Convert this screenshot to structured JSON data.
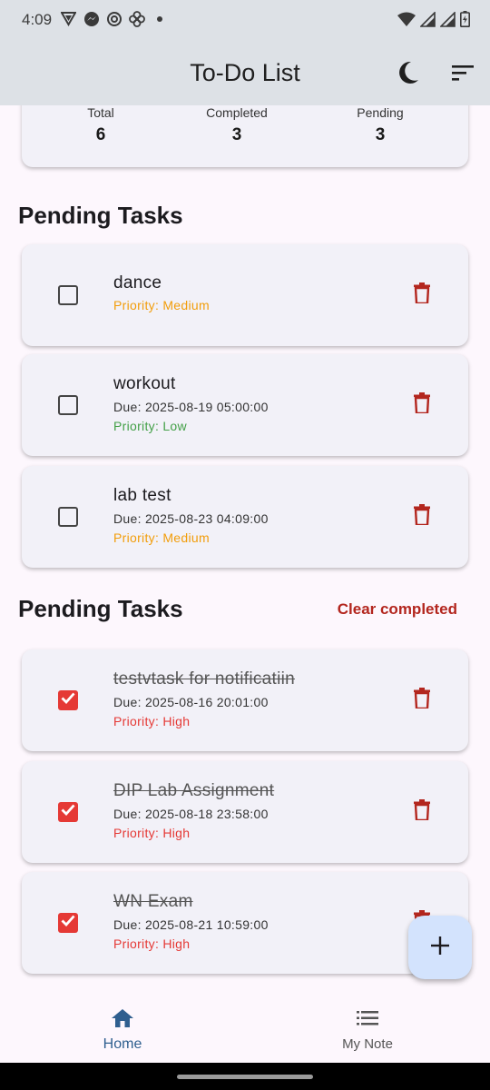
{
  "status_bar": {
    "time": "4:09",
    "icons": [
      "vpn-icon",
      "messenger-icon",
      "sync-icon",
      "pinwheel-icon",
      "dot-icon",
      "wifi-icon",
      "signal-icon",
      "signal-icon",
      "battery-icon"
    ]
  },
  "app_bar": {
    "title": "To-Do List",
    "actions": [
      "dark-mode-icon",
      "sort-icon"
    ]
  },
  "summary": {
    "total_label": "Total",
    "total_value": "6",
    "completed_label": "Completed",
    "completed_value": "3",
    "pending_label": "Pending",
    "pending_value": "3"
  },
  "pending_section": {
    "title": "Pending Tasks",
    "tasks": [
      {
        "title": "dance",
        "due": "",
        "priority": "Priority: Medium",
        "priority_color": "#f29d0a",
        "checked": false
      },
      {
        "title": "workout",
        "due": "Due: 2025-08-19 05:00:00",
        "priority": "Priority: Low",
        "priority_color": "#43a047",
        "checked": false
      },
      {
        "title": "lab test",
        "due": "Due: 2025-08-23 04:09:00",
        "priority": "Priority: Medium",
        "priority_color": "#f29d0a",
        "checked": false
      }
    ]
  },
  "completed_section": {
    "title": "Pending Tasks",
    "clear_label": "Clear completed",
    "tasks": [
      {
        "title": "testvtask for notificatiin",
        "due": "Due: 2025-08-16 20:01:00",
        "priority": "Priority: High",
        "priority_color": "#e53935",
        "checked": true
      },
      {
        "title": "DIP Lab Assignment",
        "due": "Due: 2025-08-18 23:58:00",
        "priority": "Priority: High",
        "priority_color": "#e53935",
        "checked": true
      },
      {
        "title": "WN Exam",
        "due": "Due: 2025-08-21 10:59:00",
        "priority": "Priority: High",
        "priority_color": "#e53935",
        "checked": true
      }
    ]
  },
  "fab": {
    "icon": "add-icon"
  },
  "bottom_nav": {
    "home_label": "Home",
    "notes_label": "My Note",
    "active_color": "#2f5f8f"
  },
  "colors": {
    "accent_red": "#b3261e",
    "checkbox_red": "#e53935",
    "card_bg": "#f2f1f8",
    "appbar_bg": "#dde1e6"
  }
}
